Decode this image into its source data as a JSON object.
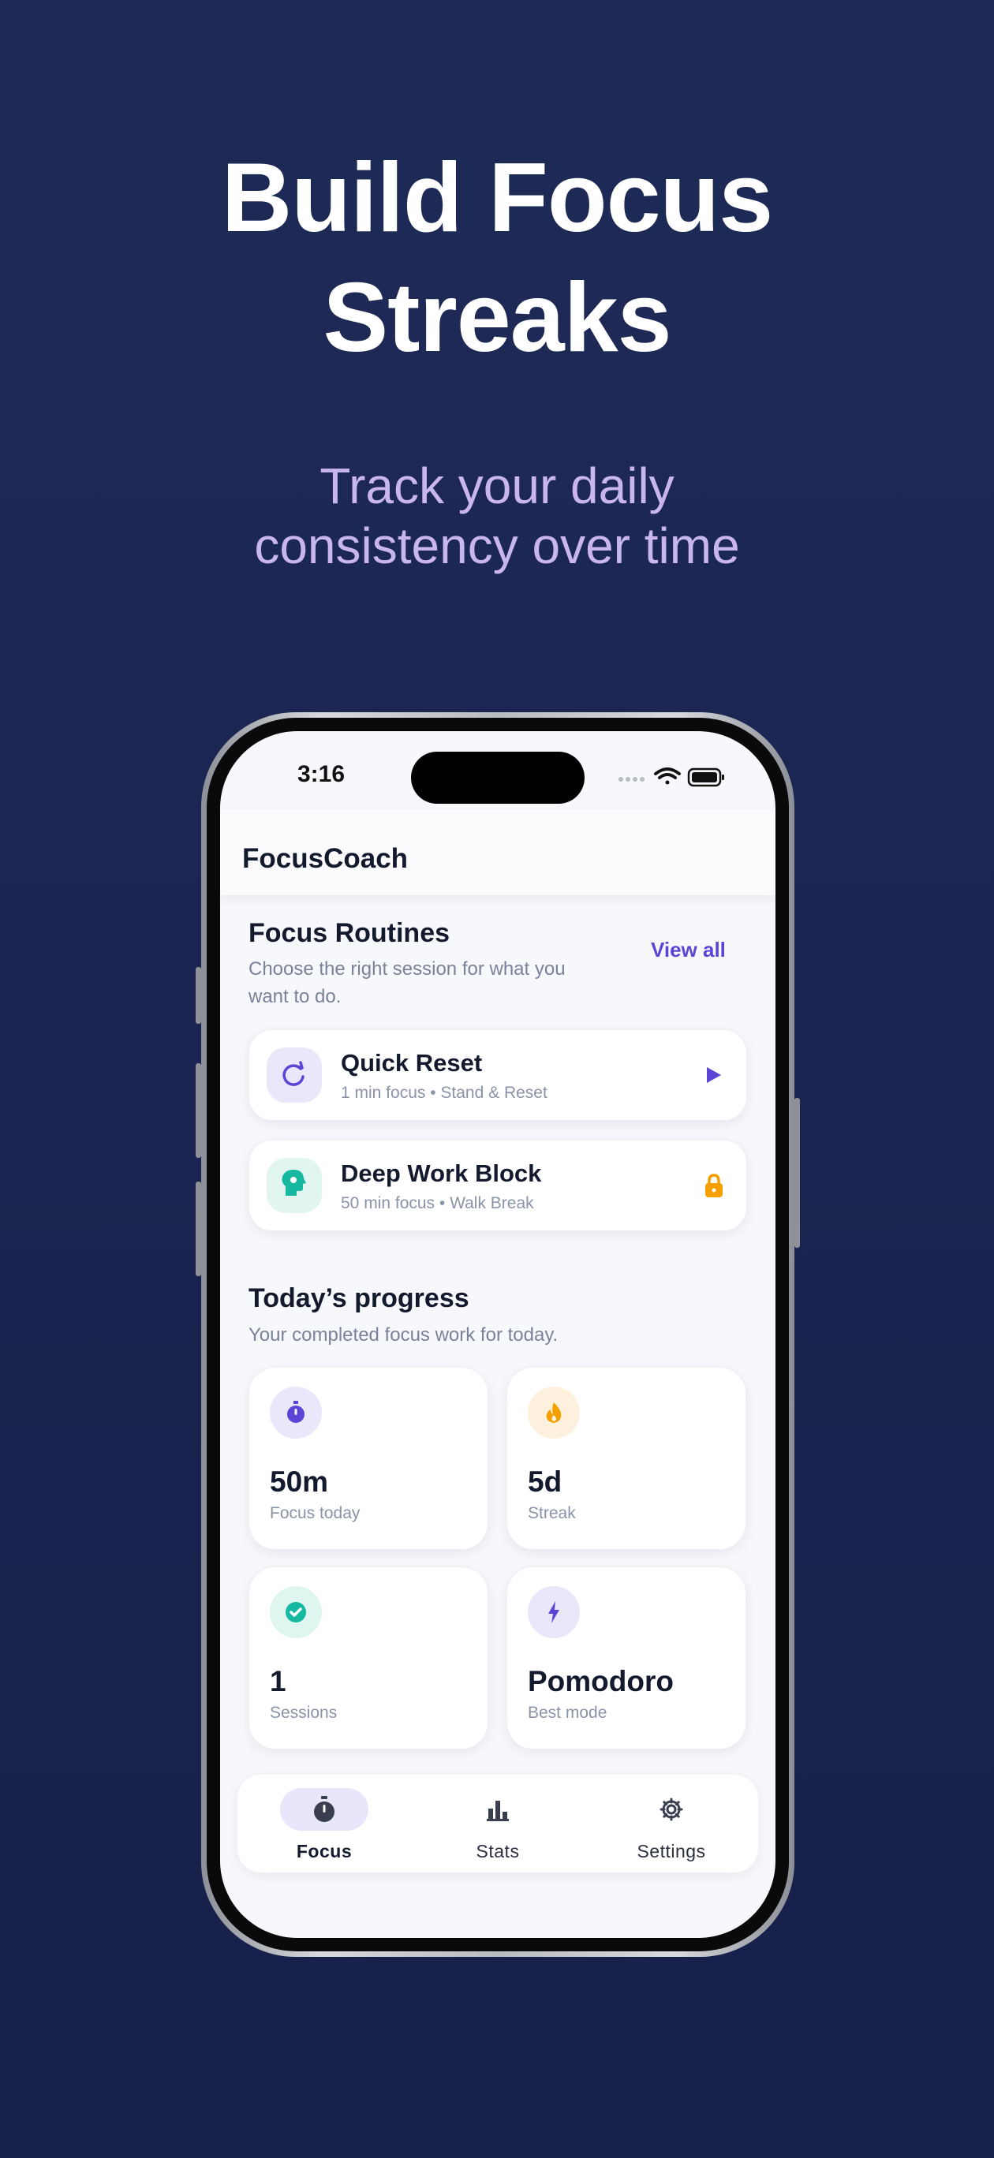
{
  "hero": {
    "title_line1": "Build Focus",
    "title_line2": "Streaks",
    "subtitle_line1": "Track your daily",
    "subtitle_line2": "consistency over time"
  },
  "status_bar": {
    "time": "3:16"
  },
  "app": {
    "title": "FocusCoach"
  },
  "routines": {
    "title": "Focus Routines",
    "subtitle_line1": "Choose the right session for what you",
    "subtitle_line2": "want to do.",
    "view_all": "View all",
    "items": [
      {
        "title": "Quick Reset",
        "meta": "1 min focus • Stand & Reset",
        "icon": "refresh-icon",
        "action": "play-icon"
      },
      {
        "title": "Deep Work Block",
        "meta": "50 min focus • Walk Break",
        "icon": "brain-icon",
        "action": "lock-icon"
      }
    ]
  },
  "progress": {
    "title": "Today’s progress",
    "subtitle": "Your completed focus work for today.",
    "stats": [
      {
        "value": "50m",
        "label": "Focus today",
        "icon": "stopwatch-icon"
      },
      {
        "value": "5d",
        "label": "Streak",
        "icon": "flame-icon"
      },
      {
        "value": "1",
        "label": "Sessions",
        "icon": "check-circle-icon"
      },
      {
        "value": "Pomodoro",
        "label": "Best mode",
        "icon": "lightning-icon"
      }
    ]
  },
  "tabs": [
    {
      "label": "Focus",
      "icon": "stopwatch-icon",
      "active": true
    },
    {
      "label": "Stats",
      "icon": "bar-chart-icon",
      "active": false
    },
    {
      "label": "Settings",
      "icon": "gear-icon",
      "active": false
    }
  ],
  "colors": {
    "background": "#1c2652",
    "accent": "#5a45d6",
    "subtitle": "#c9b6ec",
    "orange": "#f5a000",
    "teal": "#16b8a0"
  }
}
